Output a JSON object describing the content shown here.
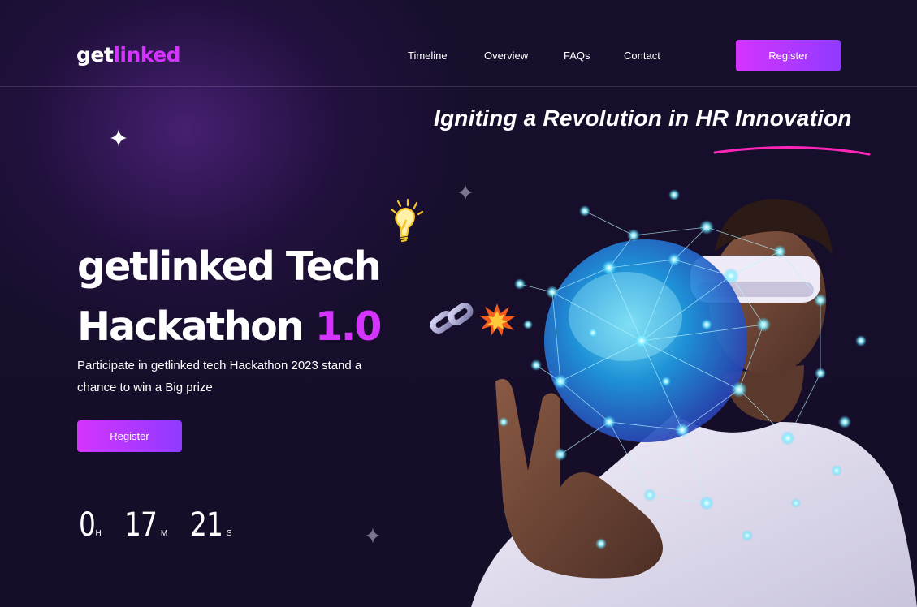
{
  "header": {
    "logo": {
      "part1": "get",
      "part2": "linked"
    },
    "nav": [
      {
        "label": "Timeline"
      },
      {
        "label": "Overview"
      },
      {
        "label": "FAQs"
      },
      {
        "label": "Contact"
      }
    ],
    "register_label": "Register"
  },
  "hero": {
    "tagline": "Igniting a Revolution in HR Innovation",
    "title_line1": "getlinked Tech",
    "title_line2_main": "Hackathon",
    "title_line2_accent": "1.0",
    "subtitle": "Participate in getlinked tech Hackathon 2023 stand a chance to win a Big prize",
    "register_label": "Register",
    "icons": [
      "lightbulb-icon",
      "chain-link-icon",
      "explosion-icon",
      "sparkle-star-icon"
    ]
  },
  "countdown": {
    "hours": "0",
    "hours_unit": "H",
    "minutes": "17",
    "minutes_unit": "M",
    "seconds": "21",
    "seconds_unit": "S"
  },
  "colors": {
    "background": "#150e28",
    "accent": "#d434fe",
    "button_gradient_end": "#903aff",
    "tagline_underline": "#ff26b9"
  }
}
